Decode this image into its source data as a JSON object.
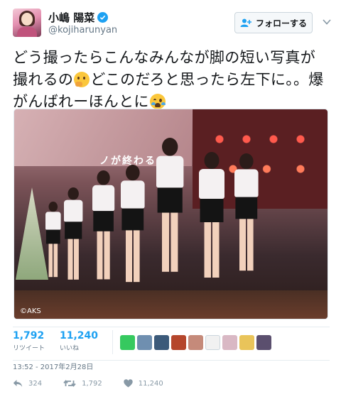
{
  "user": {
    "display_name": "小嶋 陽菜",
    "handle": "@kojiharunyan",
    "verified": true
  },
  "follow_button": {
    "label": "フォローする",
    "icon": "add-user-icon"
  },
  "tweet": {
    "text_part1": "どう撮ったらこんなみんなが脚の短い写真が撮れるの",
    "emoji1": "thinking-face",
    "text_part2": "どこのだろと思ったら左下に。。爆がんばれーほんとに",
    "emoji2": "loudly-crying-face"
  },
  "photo": {
    "credit": "©AKS",
    "screen_text": "ノが終わる"
  },
  "stats": {
    "retweets_count": "1,792",
    "retweets_label": "リツイート",
    "likes_count": "11,240",
    "likes_label": "いいね"
  },
  "timestamp": "13:52 - 2017年2月28日",
  "actions": {
    "reply_count": "324",
    "retweet_count": "1,792",
    "like_count": "11,240"
  },
  "colors": {
    "accent": "#1da1f2",
    "muted": "#657786"
  }
}
